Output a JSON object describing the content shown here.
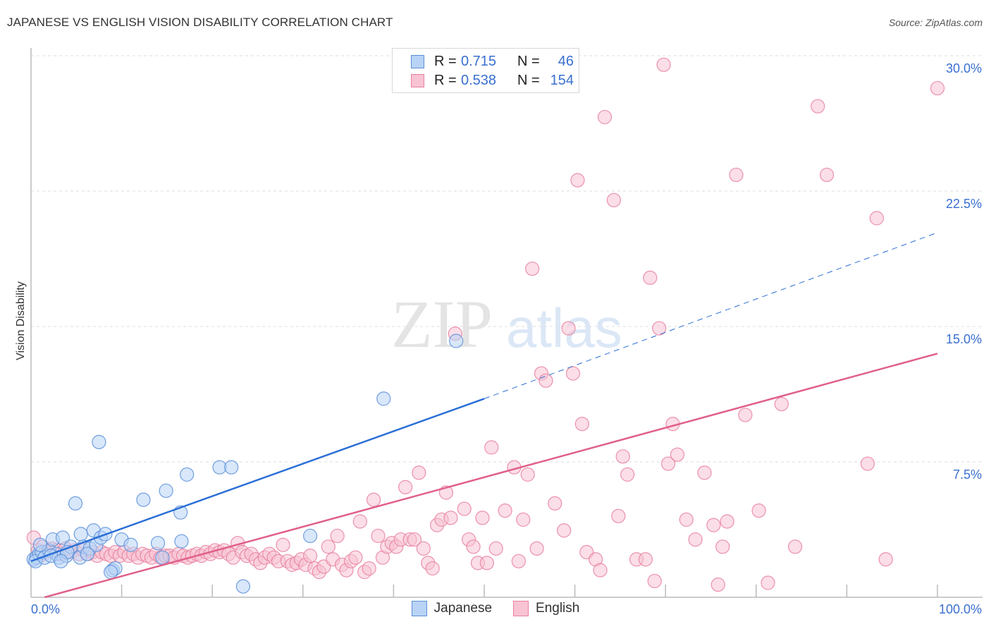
{
  "header": {
    "title": "JAPANESE VS ENGLISH VISION DISABILITY CORRELATION CHART",
    "source": "Source: ZipAtlas.com"
  },
  "watermark": {
    "zip": "ZIP",
    "atlas": "atlas"
  },
  "stats": [
    {
      "series": "Japanese",
      "r_label": "R =",
      "r_value": "0.715",
      "n_label": "N =",
      "n_value": "46"
    },
    {
      "series": "English",
      "r_label": "R =",
      "r_value": "0.538",
      "n_label": "N =",
      "n_value": "154"
    }
  ],
  "colors": {
    "japanese_fill": "#b8d3f5",
    "japanese_stroke": "#5b8fd9",
    "japanese_line": "#2b6fd6",
    "english_fill": "#f8c3d3",
    "english_stroke": "#e8809f",
    "english_line": "#e0608a",
    "tick_text": "#3a6fd0",
    "grid": "#dcdcdc"
  },
  "chart_data": {
    "type": "scatter",
    "title": "JAPANESE VS ENGLISH VISION DISABILITY CORRELATION CHART",
    "xlabel": "",
    "ylabel": "Vision Disability",
    "xlim": [
      0,
      100
    ],
    "ylim": [
      0,
      30.5
    ],
    "x_tick_labels": [
      {
        "value": 0,
        "label": "0.0%"
      },
      {
        "value": 100,
        "label": "100.0%"
      }
    ],
    "x_minor_ticks": [
      10,
      20,
      30,
      40,
      50,
      60,
      70,
      80,
      90,
      100
    ],
    "y_ticks": [
      {
        "value": 7.5,
        "label": "7.5%"
      },
      {
        "value": 15.0,
        "label": "15.0%"
      },
      {
        "value": 22.5,
        "label": "22.5%"
      },
      {
        "value": 30.0,
        "label": "30.0%"
      }
    ],
    "grid": "horizontal-dashed",
    "legend": {
      "position": "bottom-center",
      "entries": [
        "Japanese",
        "English"
      ]
    },
    "series": [
      {
        "name": "Japanese",
        "r": 0.715,
        "n": 46,
        "trend": {
          "x0": 0,
          "y0": 2.0,
          "x1": 50,
          "y1": 11.0,
          "dashed_to_x": 100,
          "dashed_to_y": 20.2
        },
        "points": [
          [
            0.3,
            2.1
          ],
          [
            0.6,
            2.2
          ],
          [
            0.9,
            2.4
          ],
          [
            0.5,
            2.0
          ],
          [
            1.2,
            2.5
          ],
          [
            1.5,
            2.2
          ],
          [
            2.0,
            2.6
          ],
          [
            2.4,
            3.2
          ],
          [
            2.8,
            2.4
          ],
          [
            3.1,
            2.2
          ],
          [
            3.5,
            3.3
          ],
          [
            3.9,
            2.3
          ],
          [
            4.4,
            2.8
          ],
          [
            4.9,
            5.2
          ],
          [
            5.4,
            2.2
          ],
          [
            5.5,
            3.5
          ],
          [
            5.8,
            2.8
          ],
          [
            6.5,
            2.7
          ],
          [
            6.9,
            3.7
          ],
          [
            7.2,
            2.9
          ],
          [
            7.5,
            8.6
          ],
          [
            7.7,
            3.3
          ],
          [
            8.2,
            3.5
          ],
          [
            9.0,
            1.5
          ],
          [
            9.3,
            1.6
          ],
          [
            10.0,
            3.2
          ],
          [
            11.0,
            2.9
          ],
          [
            12.4,
            5.4
          ],
          [
            14.0,
            3.0
          ],
          [
            14.9,
            5.9
          ],
          [
            16.5,
            4.7
          ],
          [
            16.6,
            3.1
          ],
          [
            17.2,
            6.8
          ],
          [
            20.8,
            7.2
          ],
          [
            22.1,
            7.2
          ],
          [
            23.4,
            0.6
          ],
          [
            30.8,
            3.4
          ],
          [
            38.9,
            11.0
          ],
          [
            46.9,
            14.2
          ],
          [
            1.0,
            2.9
          ],
          [
            2.2,
            2.3
          ],
          [
            4.0,
            2.5
          ],
          [
            6.2,
            2.4
          ],
          [
            8.8,
            1.4
          ],
          [
            14.5,
            2.2
          ],
          [
            3.3,
            2.0
          ]
        ]
      },
      {
        "name": "English",
        "r": 0.538,
        "n": 154,
        "trend": {
          "x0": 1.5,
          "y0": 0.0,
          "x1": 100,
          "y1": 13.5
        },
        "points": [
          [
            0.3,
            3.3
          ],
          [
            0.8,
            2.6
          ],
          [
            1.3,
            2.8
          ],
          [
            1.8,
            2.5
          ],
          [
            2.3,
            2.7
          ],
          [
            2.8,
            2.6
          ],
          [
            3.3,
            2.4
          ],
          [
            3.8,
            2.7
          ],
          [
            4.3,
            2.5
          ],
          [
            4.8,
            2.6
          ],
          [
            5.3,
            2.4
          ],
          [
            5.8,
            2.6
          ],
          [
            6.3,
            2.4
          ],
          [
            6.8,
            2.5
          ],
          [
            7.3,
            2.3
          ],
          [
            7.8,
            2.5
          ],
          [
            8.3,
            2.4
          ],
          [
            8.8,
            2.3
          ],
          [
            9.3,
            2.5
          ],
          [
            9.8,
            2.3
          ],
          [
            10.3,
            2.5
          ],
          [
            10.8,
            2.3
          ],
          [
            11.3,
            2.4
          ],
          [
            11.8,
            2.2
          ],
          [
            12.3,
            2.4
          ],
          [
            12.8,
            2.3
          ],
          [
            13.3,
            2.2
          ],
          [
            13.8,
            2.4
          ],
          [
            14.3,
            2.2
          ],
          [
            14.8,
            2.3
          ],
          [
            15.3,
            2.3
          ],
          [
            15.8,
            2.2
          ],
          [
            16.3,
            2.4
          ],
          [
            16.8,
            2.3
          ],
          [
            17.3,
            2.2
          ],
          [
            17.8,
            2.3
          ],
          [
            18.3,
            2.4
          ],
          [
            18.8,
            2.3
          ],
          [
            19.3,
            2.5
          ],
          [
            19.8,
            2.4
          ],
          [
            20.3,
            2.6
          ],
          [
            20.8,
            2.5
          ],
          [
            21.3,
            2.6
          ],
          [
            21.8,
            2.4
          ],
          [
            22.3,
            2.2
          ],
          [
            22.8,
            3.0
          ],
          [
            23.3,
            2.5
          ],
          [
            23.8,
            2.3
          ],
          [
            24.3,
            2.4
          ],
          [
            24.8,
            2.1
          ],
          [
            25.3,
            1.9
          ],
          [
            25.8,
            2.2
          ],
          [
            26.3,
            2.4
          ],
          [
            26.8,
            2.2
          ],
          [
            27.3,
            2.0
          ],
          [
            27.8,
            2.9
          ],
          [
            28.3,
            2.0
          ],
          [
            28.8,
            1.8
          ],
          [
            29.3,
            1.9
          ],
          [
            29.8,
            2.1
          ],
          [
            30.3,
            1.8
          ],
          [
            30.8,
            2.3
          ],
          [
            31.3,
            1.6
          ],
          [
            31.8,
            1.4
          ],
          [
            32.3,
            1.7
          ],
          [
            32.8,
            2.8
          ],
          [
            33.3,
            2.1
          ],
          [
            33.8,
            3.4
          ],
          [
            34.3,
            1.8
          ],
          [
            34.8,
            1.5
          ],
          [
            35.3,
            2.0
          ],
          [
            35.8,
            2.2
          ],
          [
            36.3,
            4.2
          ],
          [
            36.8,
            1.4
          ],
          [
            37.3,
            1.6
          ],
          [
            37.8,
            5.4
          ],
          [
            38.3,
            3.4
          ],
          [
            38.8,
            2.2
          ],
          [
            39.3,
            2.8
          ],
          [
            39.8,
            3.0
          ],
          [
            40.3,
            2.8
          ],
          [
            40.8,
            3.2
          ],
          [
            41.3,
            6.1
          ],
          [
            41.8,
            3.2
          ],
          [
            42.3,
            3.2
          ],
          [
            42.8,
            6.9
          ],
          [
            43.3,
            2.7
          ],
          [
            43.8,
            1.9
          ],
          [
            44.3,
            1.6
          ],
          [
            44.8,
            4.0
          ],
          [
            45.3,
            4.3
          ],
          [
            45.8,
            5.8
          ],
          [
            46.3,
            4.4
          ],
          [
            46.8,
            14.6
          ],
          [
            47.8,
            4.9
          ],
          [
            48.3,
            3.2
          ],
          [
            48.8,
            2.8
          ],
          [
            49.3,
            1.9
          ],
          [
            49.8,
            4.4
          ],
          [
            50.3,
            1.9
          ],
          [
            50.8,
            8.3
          ],
          [
            51.3,
            2.7
          ],
          [
            52.3,
            4.8
          ],
          [
            53.3,
            7.2
          ],
          [
            53.8,
            2.0
          ],
          [
            54.3,
            4.3
          ],
          [
            54.8,
            6.8
          ],
          [
            55.3,
            18.2
          ],
          [
            55.8,
            2.7
          ],
          [
            56.3,
            12.4
          ],
          [
            56.8,
            12.0
          ],
          [
            57.8,
            5.2
          ],
          [
            58.8,
            3.7
          ],
          [
            59.3,
            14.9
          ],
          [
            59.8,
            12.4
          ],
          [
            60.3,
            23.1
          ],
          [
            60.8,
            9.6
          ],
          [
            61.3,
            2.5
          ],
          [
            62.3,
            2.1
          ],
          [
            62.8,
            1.5
          ],
          [
            63.3,
            26.6
          ],
          [
            64.3,
            22.0
          ],
          [
            64.8,
            4.5
          ],
          [
            65.3,
            7.8
          ],
          [
            65.8,
            6.8
          ],
          [
            66.8,
            2.1
          ],
          [
            67.8,
            2.1
          ],
          [
            68.3,
            17.7
          ],
          [
            68.8,
            0.9
          ],
          [
            69.3,
            14.9
          ],
          [
            69.8,
            29.5
          ],
          [
            70.3,
            7.4
          ],
          [
            70.8,
            9.6
          ],
          [
            71.3,
            7.9
          ],
          [
            72.3,
            4.3
          ],
          [
            73.3,
            3.2
          ],
          [
            74.3,
            6.9
          ],
          [
            75.3,
            4.0
          ],
          [
            75.8,
            0.7
          ],
          [
            76.3,
            2.8
          ],
          [
            76.8,
            4.2
          ],
          [
            77.8,
            23.4
          ],
          [
            78.8,
            10.1
          ],
          [
            80.3,
            4.8
          ],
          [
            81.3,
            0.8
          ],
          [
            82.8,
            10.7
          ],
          [
            84.3,
            2.8
          ],
          [
            86.8,
            27.2
          ],
          [
            87.8,
            23.4
          ],
          [
            92.3,
            7.4
          ],
          [
            93.3,
            21.0
          ],
          [
            94.3,
            2.1
          ],
          [
            100.0,
            28.2
          ],
          [
            1.0,
            2.3
          ]
        ]
      }
    ]
  }
}
